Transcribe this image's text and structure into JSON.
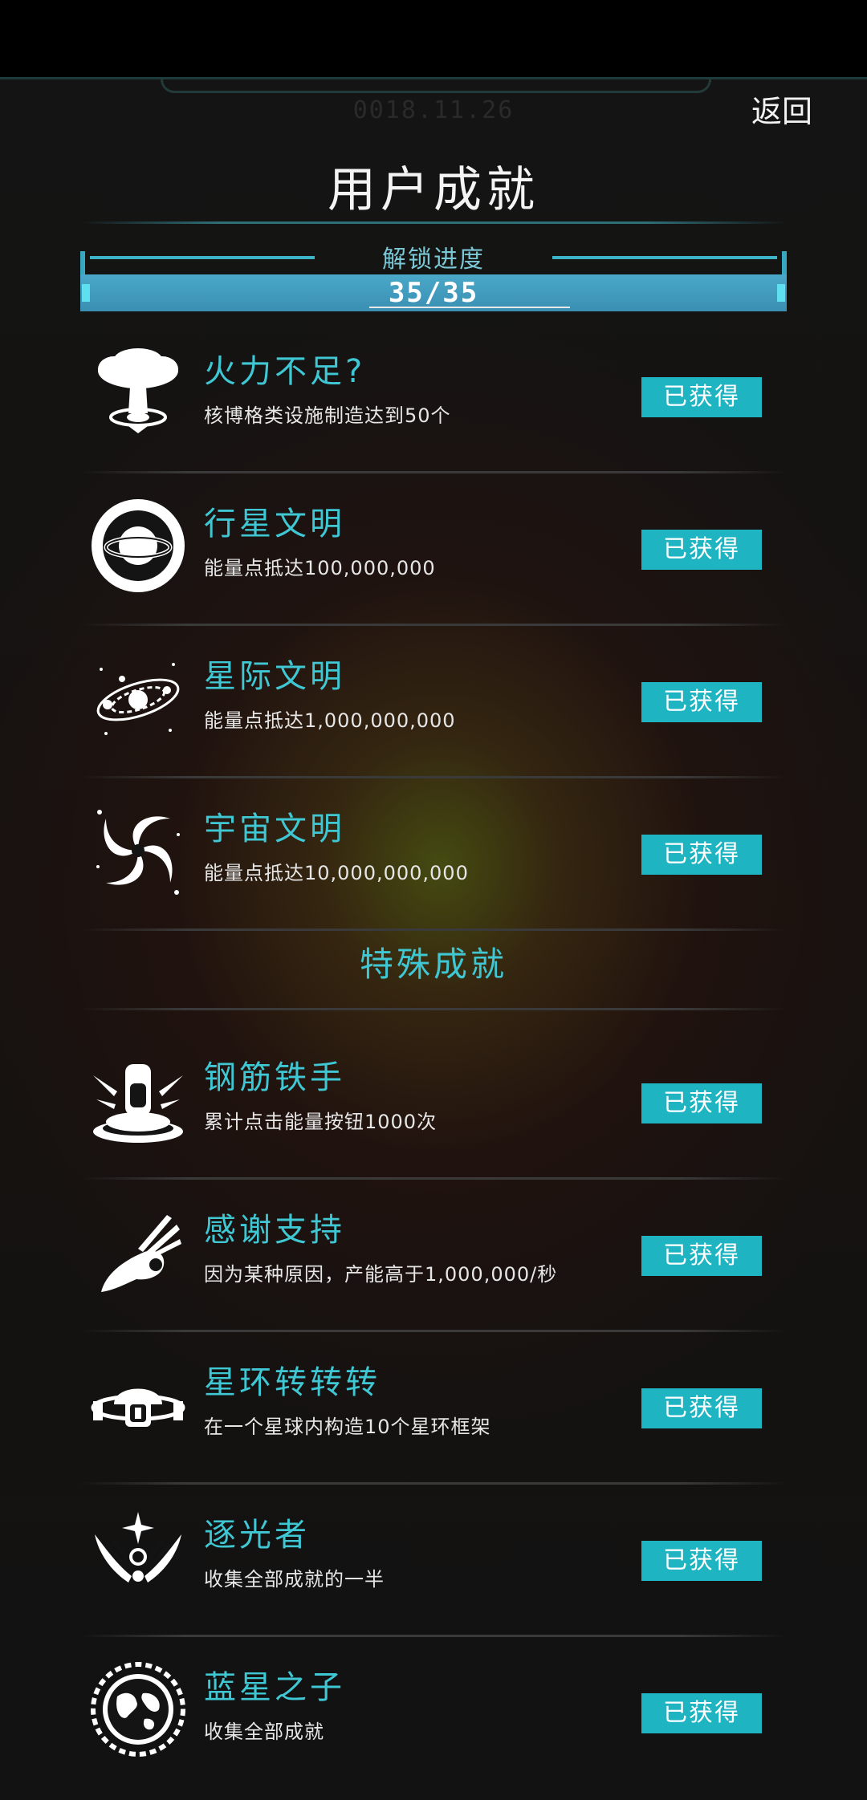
{
  "header": {
    "date": "0018.11.26",
    "back_label": "返回",
    "title": "用户成就"
  },
  "progress": {
    "label": "解锁进度",
    "text": "35/35",
    "fraction": 1.0
  },
  "achievements": [
    {
      "name": "火力不足?",
      "desc": "核博格类设施制造达到50个",
      "status": "已获得",
      "icon": "mushroom-cloud-icon"
    },
    {
      "name": "行星文明",
      "desc": "能量点抵达100,000,000",
      "status": "已获得",
      "icon": "ringed-planet-icon"
    },
    {
      "name": "星际文明",
      "desc": "能量点抵达1,000,000,000",
      "status": "已获得",
      "icon": "star-system-icon"
    },
    {
      "name": "宇宙文明",
      "desc": "能量点抵达10,000,000,000",
      "status": "已获得",
      "icon": "spiral-galaxy-icon"
    }
  ],
  "special_section": {
    "title": "特殊成就"
  },
  "special_achievements": [
    {
      "name": "钢筋铁手",
      "desc": "累计点击能量按钮1000次",
      "status": "已获得",
      "icon": "button-press-icon"
    },
    {
      "name": "感谢支持",
      "desc": "因为某种原因，产能高于1,000,000/秒",
      "status": "已获得",
      "icon": "ok-hand-icon"
    },
    {
      "name": "星环转转转",
      "desc": "在一个星球内构造10个星环框架",
      "status": "已获得",
      "icon": "space-station-icon"
    },
    {
      "name": "逐光者",
      "desc": "收集全部成就的一半",
      "status": "已获得",
      "icon": "winged-star-icon"
    },
    {
      "name": "蓝星之子",
      "desc": "收集全部成就",
      "status": "已获得",
      "icon": "earth-emblem-icon"
    }
  ]
}
